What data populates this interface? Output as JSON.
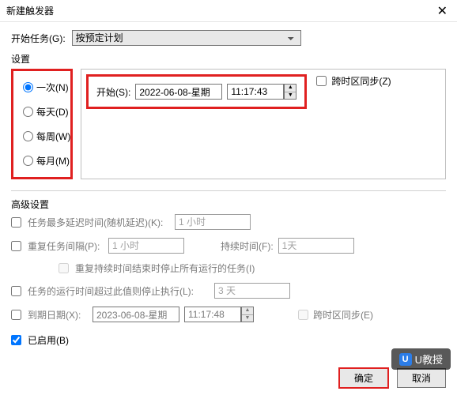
{
  "window": {
    "title": "新建触发器"
  },
  "begin": {
    "label": "开始任务(G):",
    "value": "按预定计划"
  },
  "settings": {
    "label": "设置",
    "radios": {
      "once": "一次(N)",
      "daily": "每天(D)",
      "weekly": "每周(W)",
      "monthly": "每月(M)"
    },
    "startLabel": "开始(S):",
    "startDate": "2022-06-08-星期",
    "startTime": "11:17:43",
    "tzSync": "跨时区同步(Z)"
  },
  "adv": {
    "label": "高级设置",
    "delay": {
      "label": "任务最多延迟时间(随机延迟)(K):",
      "value": "1 小时"
    },
    "repeat": {
      "label": "重复任务间隔(P):",
      "value": "1 小时",
      "durationLabel": "持续时间(F):",
      "durationValue": "1天",
      "stopAtEnd": "重复持续时间结束时停止所有运行的任务(I)"
    },
    "stopAfter": {
      "label": "任务的运行时间超过此值则停止执行(L):",
      "value": "3 天"
    },
    "expire": {
      "label": "到期日期(X):",
      "date": "2023-06-08-星期",
      "time": "11:17:48",
      "tz": "跨时区同步(E)"
    },
    "enabled": "已启用(B)"
  },
  "buttons": {
    "ok": "确定",
    "cancel": "取消"
  },
  "watermark": "U教授"
}
